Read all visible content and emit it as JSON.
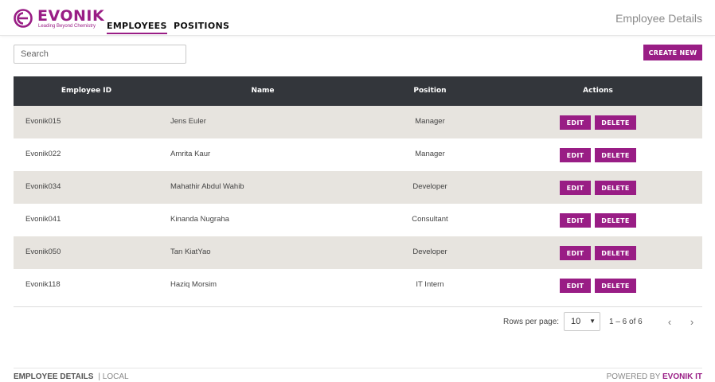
{
  "brand": {
    "name": "EVONIK",
    "tagline": "Leading Beyond Chemistry",
    "accent_color": "#991d85"
  },
  "nav": {
    "items": [
      {
        "label": "EMPLOYEES",
        "active": true
      },
      {
        "label": "POSITIONS",
        "active": false
      }
    ]
  },
  "app_title": "Employee Details",
  "search": {
    "placeholder": "Search",
    "value": ""
  },
  "toolbar": {
    "create_label": "CREATE NEW"
  },
  "table": {
    "columns": [
      "Employee ID",
      "Name",
      "Position",
      "Actions"
    ],
    "rows": [
      {
        "id": "Evonik015",
        "name": "Jens Euler",
        "position": "Manager",
        "edit": "EDIT",
        "delete": "DELETE"
      },
      {
        "id": "Evonik022",
        "name": "Amrita Kaur",
        "position": "Manager",
        "edit": "EDIT",
        "delete": "DELETE"
      },
      {
        "id": "Evonik034",
        "name": "Mahathir Abdul Wahib",
        "position": "Developer",
        "edit": "EDIT",
        "delete": "DELETE"
      },
      {
        "id": "Evonik041",
        "name": "Kinanda Nugraha",
        "position": "Consultant",
        "edit": "EDIT",
        "delete": "DELETE"
      },
      {
        "id": "Evonik050",
        "name": "Tan KiatYao",
        "position": "Developer",
        "edit": "EDIT",
        "delete": "DELETE"
      },
      {
        "id": "Evonik118",
        "name": "Haziq Morsim",
        "position": "IT Intern",
        "edit": "EDIT",
        "delete": "DELETE"
      }
    ],
    "header_color": "#33363b",
    "alt_row_color": "#e7e4df"
  },
  "pagination": {
    "rows_per_page_label": "Rows per page:",
    "rows_per_page": "10",
    "range": "1 – 6 of 6",
    "prev_icon": "chevron-left-icon",
    "next_icon": "chevron-right-icon"
  },
  "footer": {
    "left_title": "EMPLOYEE DETAILS",
    "left_env": "| LOCAL",
    "right_prefix": "POWERED BY",
    "right_brand": "EVONIK IT"
  }
}
